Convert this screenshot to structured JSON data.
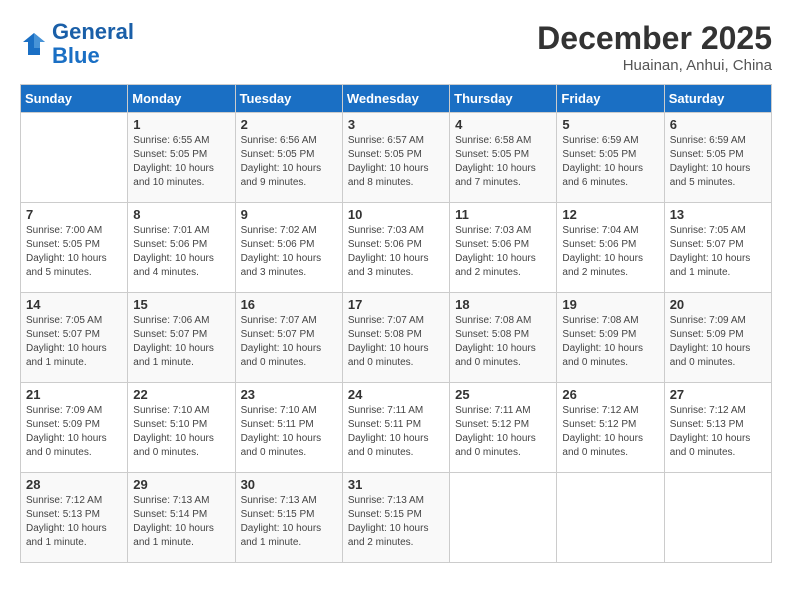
{
  "header": {
    "logo_line1": "General",
    "logo_line2": "Blue",
    "month": "December 2025",
    "location": "Huainan, Anhui, China"
  },
  "weekdays": [
    "Sunday",
    "Monday",
    "Tuesday",
    "Wednesday",
    "Thursday",
    "Friday",
    "Saturday"
  ],
  "weeks": [
    [
      {
        "day": "",
        "info": ""
      },
      {
        "day": "1",
        "info": "Sunrise: 6:55 AM\nSunset: 5:05 PM\nDaylight: 10 hours\nand 10 minutes."
      },
      {
        "day": "2",
        "info": "Sunrise: 6:56 AM\nSunset: 5:05 PM\nDaylight: 10 hours\nand 9 minutes."
      },
      {
        "day": "3",
        "info": "Sunrise: 6:57 AM\nSunset: 5:05 PM\nDaylight: 10 hours\nand 8 minutes."
      },
      {
        "day": "4",
        "info": "Sunrise: 6:58 AM\nSunset: 5:05 PM\nDaylight: 10 hours\nand 7 minutes."
      },
      {
        "day": "5",
        "info": "Sunrise: 6:59 AM\nSunset: 5:05 PM\nDaylight: 10 hours\nand 6 minutes."
      },
      {
        "day": "6",
        "info": "Sunrise: 6:59 AM\nSunset: 5:05 PM\nDaylight: 10 hours\nand 5 minutes."
      }
    ],
    [
      {
        "day": "7",
        "info": "Sunrise: 7:00 AM\nSunset: 5:05 PM\nDaylight: 10 hours\nand 5 minutes."
      },
      {
        "day": "8",
        "info": "Sunrise: 7:01 AM\nSunset: 5:06 PM\nDaylight: 10 hours\nand 4 minutes."
      },
      {
        "day": "9",
        "info": "Sunrise: 7:02 AM\nSunset: 5:06 PM\nDaylight: 10 hours\nand 3 minutes."
      },
      {
        "day": "10",
        "info": "Sunrise: 7:03 AM\nSunset: 5:06 PM\nDaylight: 10 hours\nand 3 minutes."
      },
      {
        "day": "11",
        "info": "Sunrise: 7:03 AM\nSunset: 5:06 PM\nDaylight: 10 hours\nand 2 minutes."
      },
      {
        "day": "12",
        "info": "Sunrise: 7:04 AM\nSunset: 5:06 PM\nDaylight: 10 hours\nand 2 minutes."
      },
      {
        "day": "13",
        "info": "Sunrise: 7:05 AM\nSunset: 5:07 PM\nDaylight: 10 hours\nand 1 minute."
      }
    ],
    [
      {
        "day": "14",
        "info": "Sunrise: 7:05 AM\nSunset: 5:07 PM\nDaylight: 10 hours\nand 1 minute."
      },
      {
        "day": "15",
        "info": "Sunrise: 7:06 AM\nSunset: 5:07 PM\nDaylight: 10 hours\nand 1 minute."
      },
      {
        "day": "16",
        "info": "Sunrise: 7:07 AM\nSunset: 5:07 PM\nDaylight: 10 hours\nand 0 minutes."
      },
      {
        "day": "17",
        "info": "Sunrise: 7:07 AM\nSunset: 5:08 PM\nDaylight: 10 hours\nand 0 minutes."
      },
      {
        "day": "18",
        "info": "Sunrise: 7:08 AM\nSunset: 5:08 PM\nDaylight: 10 hours\nand 0 minutes."
      },
      {
        "day": "19",
        "info": "Sunrise: 7:08 AM\nSunset: 5:09 PM\nDaylight: 10 hours\nand 0 minutes."
      },
      {
        "day": "20",
        "info": "Sunrise: 7:09 AM\nSunset: 5:09 PM\nDaylight: 10 hours\nand 0 minutes."
      }
    ],
    [
      {
        "day": "21",
        "info": "Sunrise: 7:09 AM\nSunset: 5:09 PM\nDaylight: 10 hours\nand 0 minutes."
      },
      {
        "day": "22",
        "info": "Sunrise: 7:10 AM\nSunset: 5:10 PM\nDaylight: 10 hours\nand 0 minutes."
      },
      {
        "day": "23",
        "info": "Sunrise: 7:10 AM\nSunset: 5:11 PM\nDaylight: 10 hours\nand 0 minutes."
      },
      {
        "day": "24",
        "info": "Sunrise: 7:11 AM\nSunset: 5:11 PM\nDaylight: 10 hours\nand 0 minutes."
      },
      {
        "day": "25",
        "info": "Sunrise: 7:11 AM\nSunset: 5:12 PM\nDaylight: 10 hours\nand 0 minutes."
      },
      {
        "day": "26",
        "info": "Sunrise: 7:12 AM\nSunset: 5:12 PM\nDaylight: 10 hours\nand 0 minutes."
      },
      {
        "day": "27",
        "info": "Sunrise: 7:12 AM\nSunset: 5:13 PM\nDaylight: 10 hours\nand 0 minutes."
      }
    ],
    [
      {
        "day": "28",
        "info": "Sunrise: 7:12 AM\nSunset: 5:13 PM\nDaylight: 10 hours\nand 1 minute."
      },
      {
        "day": "29",
        "info": "Sunrise: 7:13 AM\nSunset: 5:14 PM\nDaylight: 10 hours\nand 1 minute."
      },
      {
        "day": "30",
        "info": "Sunrise: 7:13 AM\nSunset: 5:15 PM\nDaylight: 10 hours\nand 1 minute."
      },
      {
        "day": "31",
        "info": "Sunrise: 7:13 AM\nSunset: 5:15 PM\nDaylight: 10 hours\nand 2 minutes."
      },
      {
        "day": "",
        "info": ""
      },
      {
        "day": "",
        "info": ""
      },
      {
        "day": "",
        "info": ""
      }
    ]
  ]
}
